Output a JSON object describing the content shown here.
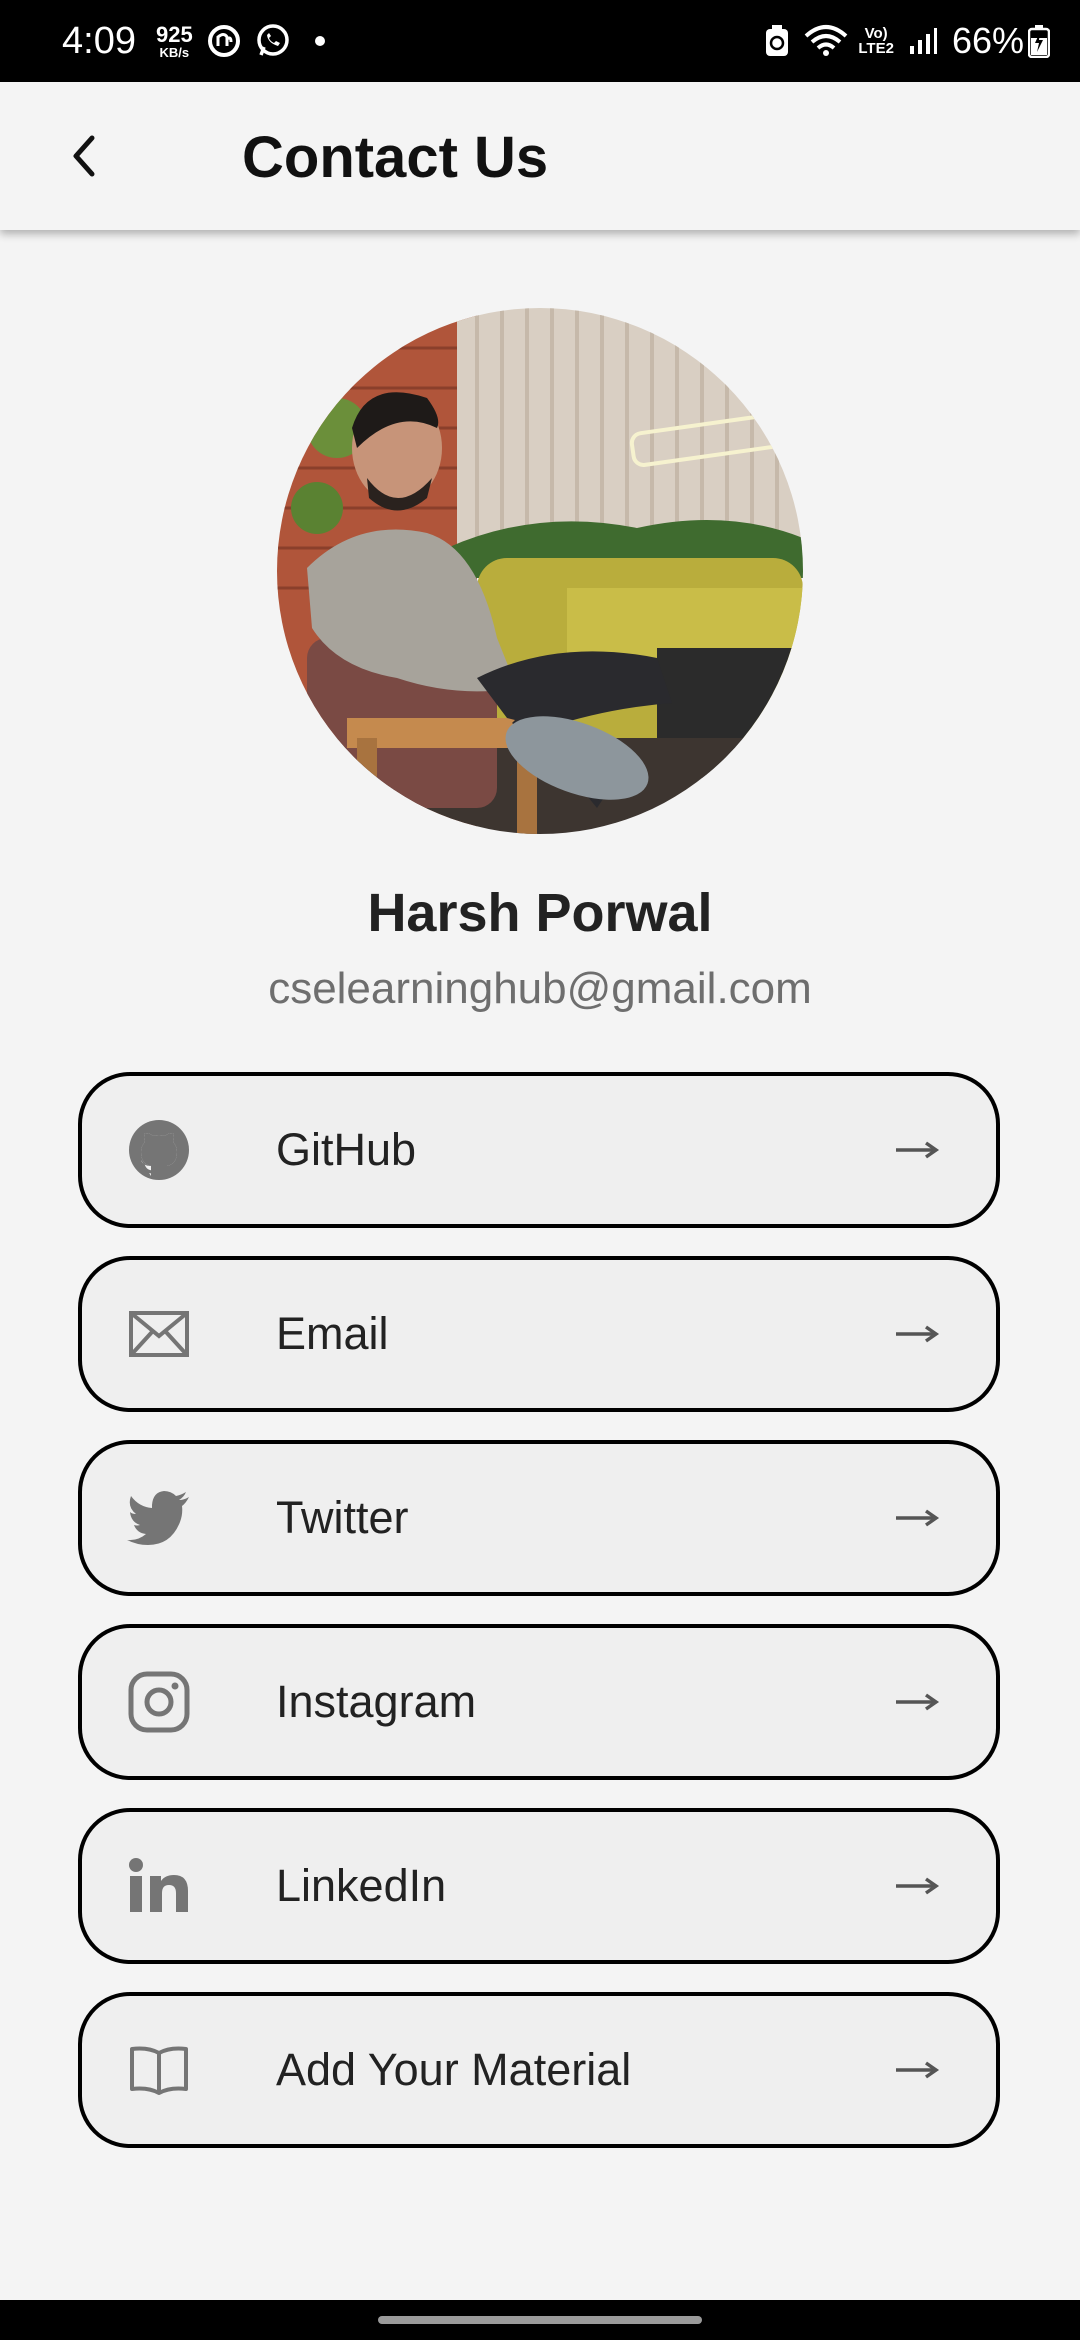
{
  "status_bar": {
    "time": "4:09",
    "net_speed_value": "925",
    "net_speed_unit": "KB/s",
    "volte_top": "Vo)",
    "volte_bottom": "LTE2",
    "battery": "66%"
  },
  "app_bar": {
    "title": "Contact Us",
    "back_icon": "chevron-left-icon"
  },
  "profile": {
    "name": "Harsh Porwal",
    "email": "cselearninghub@gmail.com"
  },
  "contacts": [
    {
      "label": "GitHub",
      "icon": "github-icon"
    },
    {
      "label": "Email",
      "icon": "envelope-icon"
    },
    {
      "label": "Twitter",
      "icon": "twitter-bird-icon"
    },
    {
      "label": "Instagram",
      "icon": "instagram-icon"
    },
    {
      "label": "LinkedIn",
      "icon": "linkedin-icon"
    },
    {
      "label": "Add Your Material",
      "icon": "open-book-icon"
    }
  ],
  "colors": {
    "background": "#f4f4f4",
    "card_background": "#efefef",
    "card_border": "#000000",
    "icon_gray": "#757575",
    "email_gray": "#6e6e6e"
  }
}
